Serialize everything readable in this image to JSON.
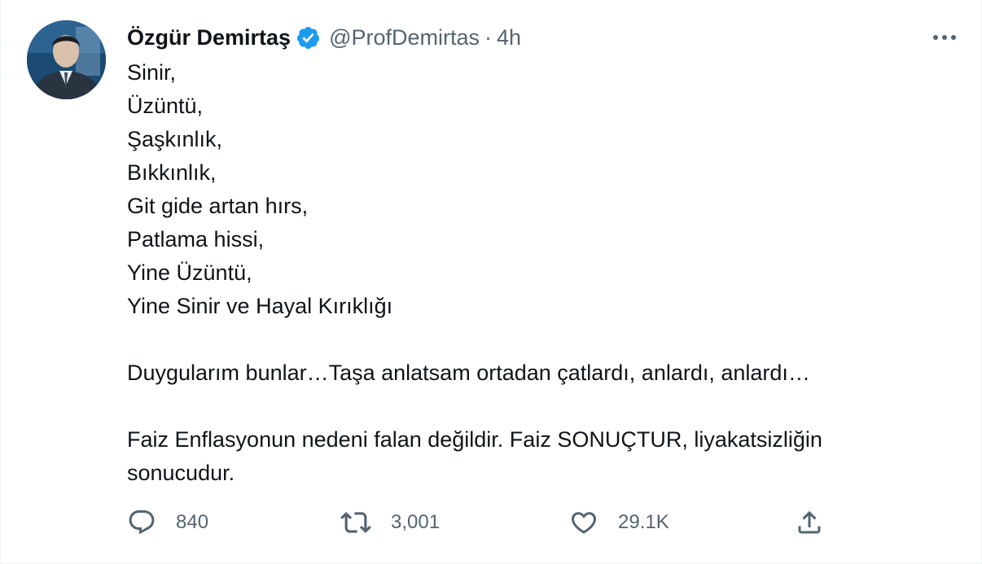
{
  "author": {
    "name": "Özgür Demirtaş",
    "handle": "@ProfDemirtas",
    "separator": "·",
    "time": "4h",
    "verified": true
  },
  "tweet": {
    "lines": [
      "Sinir,",
      "Üzüntü,",
      "Şaşkınlık,",
      "Bıkkınlık,",
      "Git gide artan hırs,",
      "Patlama hissi,",
      "Yine Üzüntü,",
      "Yine Sinir ve Hayal Kırıklığı"
    ],
    "paragraph2": "Duygularım bunlar…Taşa anlatsam ortadan çatlardı, anlardı, anlardı…",
    "paragraph3": "Faiz Enflasyonun nedeni falan değildir. Faiz SONUÇTUR, liyakatsizliğin sonucudur."
  },
  "actions": {
    "replies": "840",
    "retweets": "3,001",
    "likes": "29.1K"
  },
  "icons": {
    "more": "more-icon",
    "reply": "reply-icon",
    "retweet": "retweet-icon",
    "like": "heart-icon",
    "share": "share-icon",
    "verified": "verified-badge-icon"
  },
  "colors": {
    "text": "#0f1419",
    "secondary": "#536471",
    "verified": "#1d9bf0"
  }
}
